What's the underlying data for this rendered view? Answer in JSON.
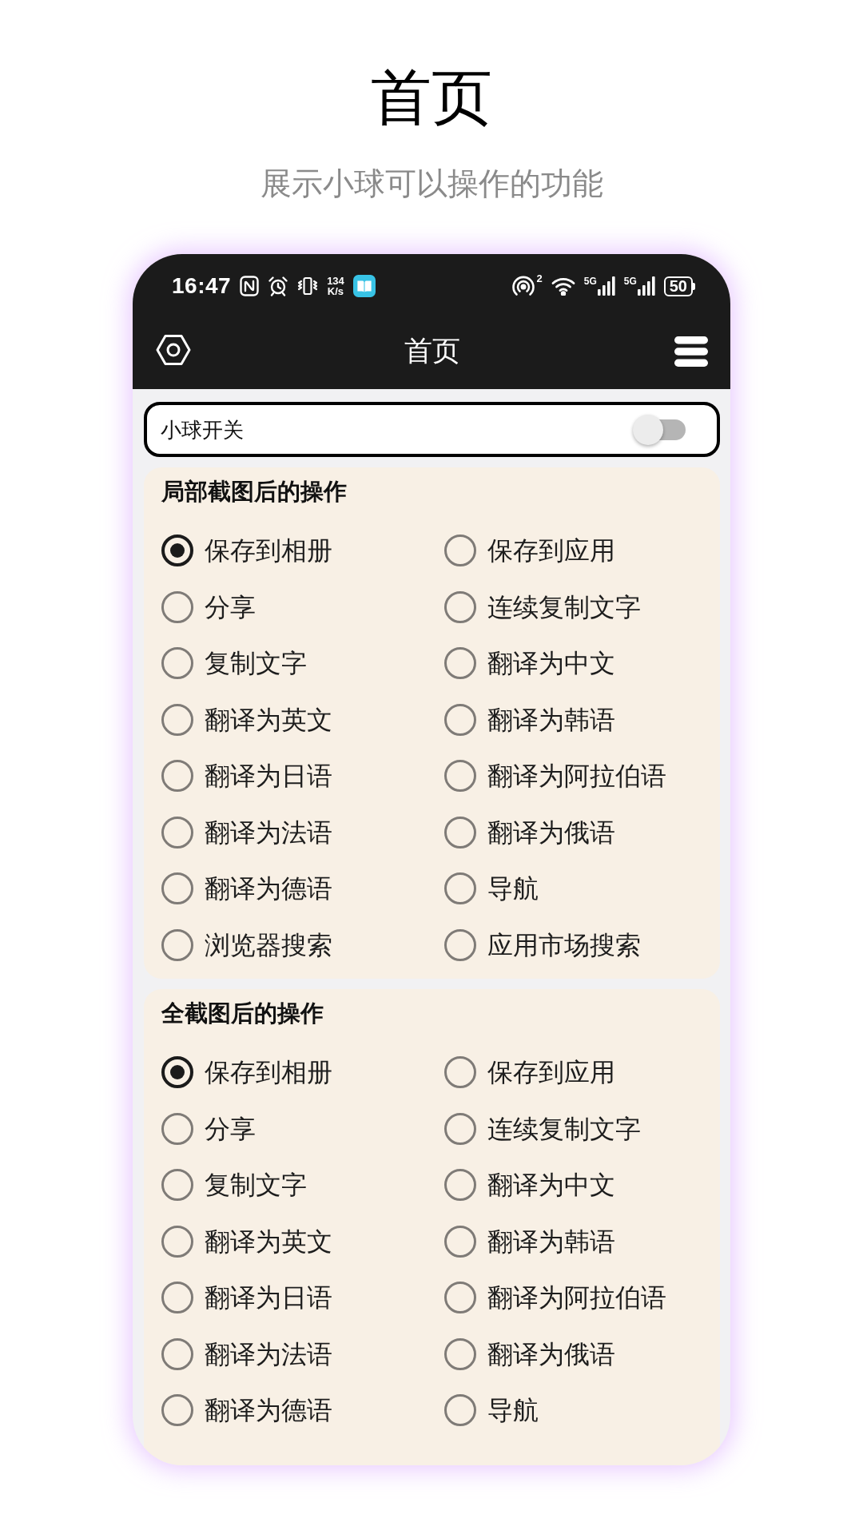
{
  "page": {
    "title": "首页",
    "subtitle": "展示小球可以操作的功能"
  },
  "status_bar": {
    "time": "16:47",
    "net_speed": "134",
    "net_unit": "K/s",
    "hotspot_count": "2",
    "signals": [
      {
        "label": "5G"
      },
      {
        "label": "5G"
      }
    ],
    "battery": "50"
  },
  "app_bar": {
    "title": "首页"
  },
  "toggle": {
    "label": "小球开关",
    "on": false
  },
  "sections": [
    {
      "title": "局部截图后的操作",
      "options": [
        {
          "label": "保存到相册",
          "selected": true
        },
        {
          "label": "保存到应用",
          "selected": false
        },
        {
          "label": "分享",
          "selected": false
        },
        {
          "label": "连续复制文字",
          "selected": false
        },
        {
          "label": "复制文字",
          "selected": false
        },
        {
          "label": "翻译为中文",
          "selected": false
        },
        {
          "label": "翻译为英文",
          "selected": false
        },
        {
          "label": "翻译为韩语",
          "selected": false
        },
        {
          "label": "翻译为日语",
          "selected": false
        },
        {
          "label": "翻译为阿拉伯语",
          "selected": false
        },
        {
          "label": "翻译为法语",
          "selected": false
        },
        {
          "label": "翻译为俄语",
          "selected": false
        },
        {
          "label": "翻译为德语",
          "selected": false
        },
        {
          "label": "导航",
          "selected": false
        },
        {
          "label": "浏览器搜索",
          "selected": false
        },
        {
          "label": "应用市场搜索",
          "selected": false
        }
      ]
    },
    {
      "title": "全截图后的操作",
      "options": [
        {
          "label": "保存到相册",
          "selected": true
        },
        {
          "label": "保存到应用",
          "selected": false
        },
        {
          "label": "分享",
          "selected": false
        },
        {
          "label": "连续复制文字",
          "selected": false
        },
        {
          "label": "复制文字",
          "selected": false
        },
        {
          "label": "翻译为中文",
          "selected": false
        },
        {
          "label": "翻译为英文",
          "selected": false
        },
        {
          "label": "翻译为韩语",
          "selected": false
        },
        {
          "label": "翻译为日语",
          "selected": false
        },
        {
          "label": "翻译为阿拉伯语",
          "selected": false
        },
        {
          "label": "翻译为法语",
          "selected": false
        },
        {
          "label": "翻译为俄语",
          "selected": false
        },
        {
          "label": "翻译为德语",
          "selected": false
        },
        {
          "label": "导航",
          "selected": false
        }
      ]
    }
  ]
}
